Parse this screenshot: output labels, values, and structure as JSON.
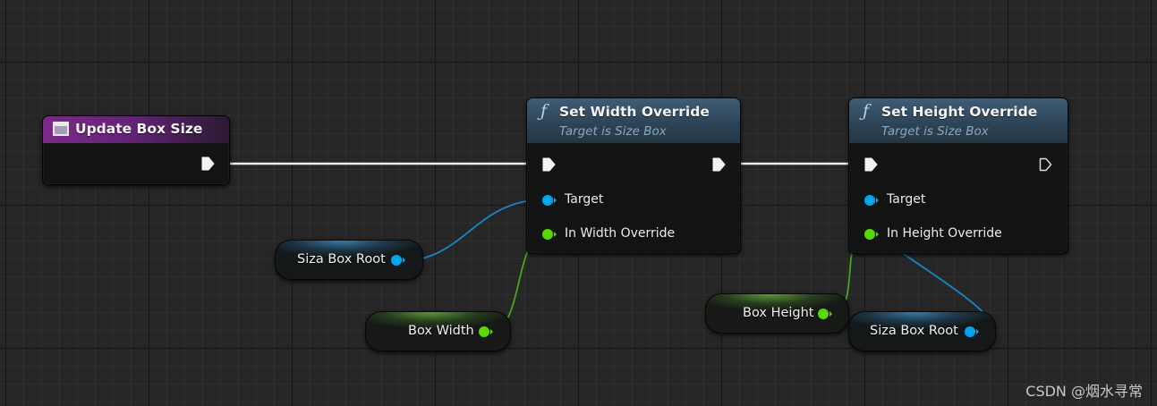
{
  "colors": {
    "exec_wire": "#f2f2f2",
    "object_pin": "#00a7f0",
    "object_wire": "#1687c8",
    "float_pin": "#59d800",
    "float_wire": "#48a420",
    "event_header": "#7a2a86",
    "function_header": "#3f5d76"
  },
  "event_node": {
    "title": "Update Box Size",
    "icon": "event-icon"
  },
  "set_width_node": {
    "icon": "function-icon",
    "icon_glyph": "ƒ",
    "title": "Set Width Override",
    "subtitle": "Target is Size Box",
    "pins": {
      "target": "Target",
      "value": "In Width Override"
    }
  },
  "set_height_node": {
    "icon": "function-icon",
    "icon_glyph": "ƒ",
    "title": "Set Height Override",
    "subtitle": "Target is Size Box",
    "pins": {
      "target": "Target",
      "value": "In Height Override"
    }
  },
  "variables": {
    "size_box_root_1": "Siza Box Root",
    "box_width": "Box Width",
    "box_height": "Box Height",
    "size_box_root_2": "Siza Box Root"
  },
  "watermark": "CSDN @烟水寻常"
}
